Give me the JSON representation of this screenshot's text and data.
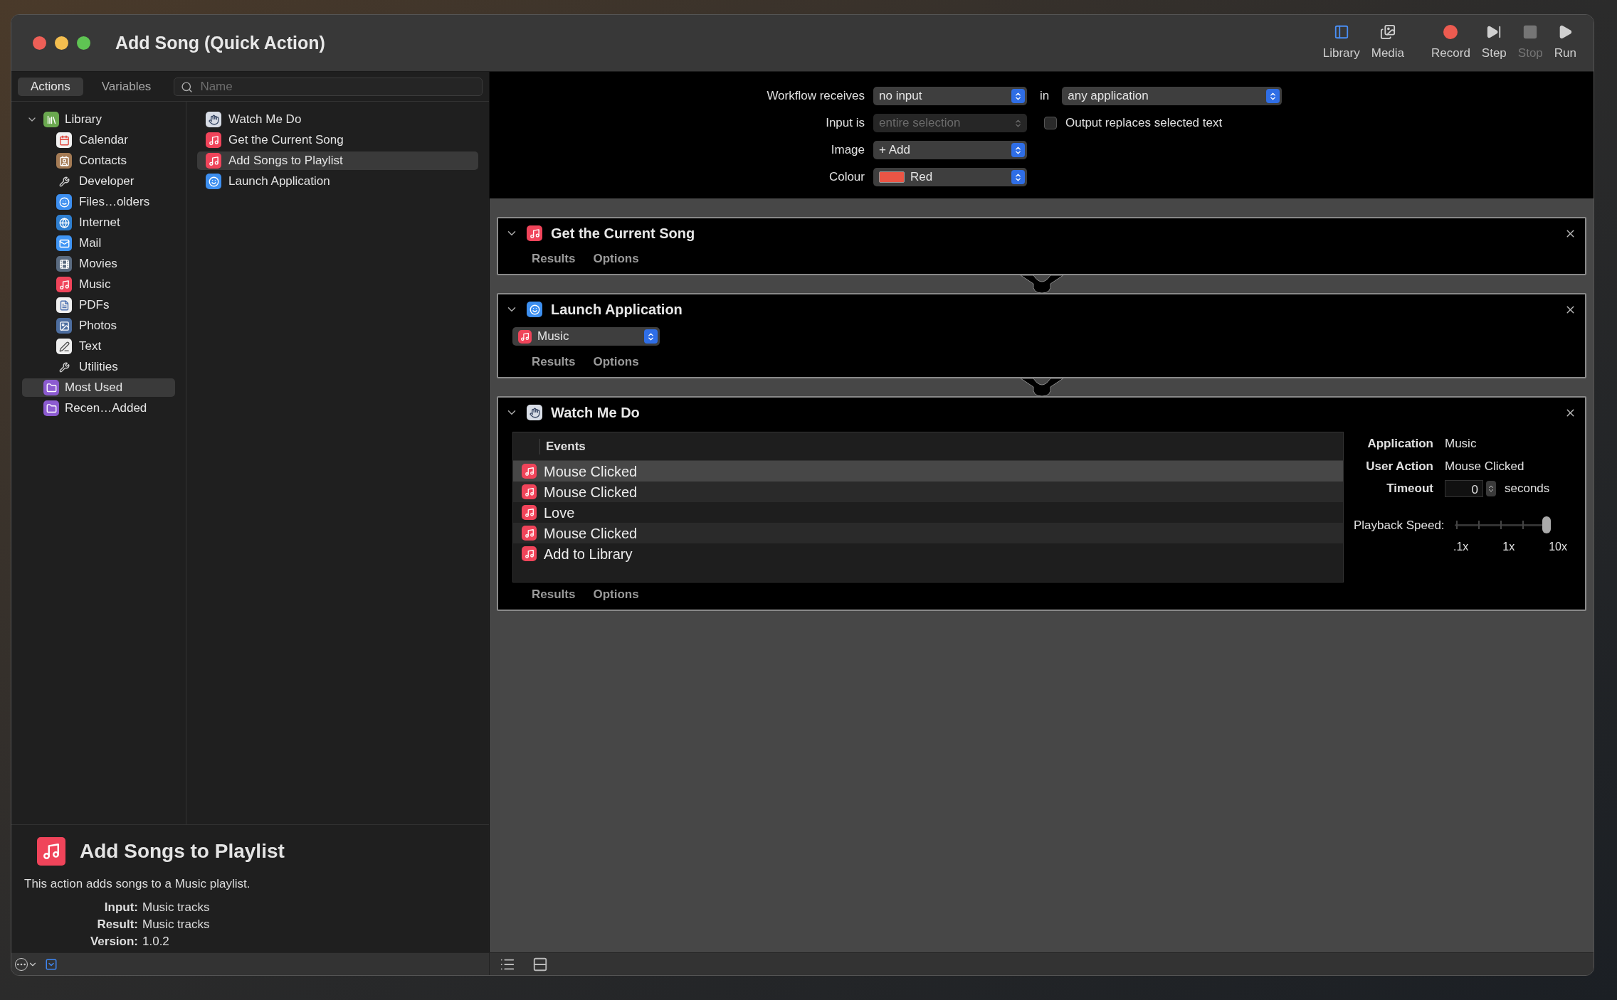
{
  "window": {
    "title": "Add Song (Quick Action)"
  },
  "toolbar": [
    {
      "label": "Library",
      "kind": "library",
      "disabled": false
    },
    {
      "label": "Media",
      "kind": "media",
      "disabled": false
    },
    {
      "label": "Record",
      "kind": "record",
      "disabled": false
    },
    {
      "label": "Step",
      "kind": "step",
      "disabled": false
    },
    {
      "label": "Stop",
      "kind": "stop",
      "disabled": true
    },
    {
      "label": "Run",
      "kind": "run",
      "disabled": false
    }
  ],
  "library_tabs": [
    {
      "label": "Actions",
      "selected": true
    },
    {
      "label": "Variables",
      "selected": false
    }
  ],
  "search": {
    "placeholder": "Name"
  },
  "library_tree": [
    {
      "label": "Library",
      "kind": "library",
      "expanded": true,
      "selected": false,
      "children": [
        {
          "label": "Calendar",
          "kind": "calendar",
          "selected": false
        },
        {
          "label": "Contacts",
          "kind": "contacts",
          "selected": false
        },
        {
          "label": "Developer",
          "kind": "tools",
          "selected": false
        },
        {
          "label": "Files…olders",
          "kind": "finder",
          "selected": false
        },
        {
          "label": "Internet",
          "kind": "globe",
          "selected": false
        },
        {
          "label": "Mail",
          "kind": "mail",
          "selected": false
        },
        {
          "label": "Movies",
          "kind": "movies",
          "selected": false
        },
        {
          "label": "Music",
          "kind": "music",
          "selected": false
        },
        {
          "label": "PDFs",
          "kind": "pdf",
          "selected": false
        },
        {
          "label": "Photos",
          "kind": "photos",
          "selected": false
        },
        {
          "label": "Text",
          "kind": "text",
          "selected": false
        },
        {
          "label": "Utilities",
          "kind": "tools",
          "selected": false
        }
      ]
    },
    {
      "label": "Most Used",
      "kind": "folder",
      "selected": true
    },
    {
      "label": "Recen…Added",
      "kind": "folder",
      "selected": false
    }
  ],
  "actions": [
    {
      "label": "Watch Me Do",
      "kind": "watch",
      "selected": false
    },
    {
      "label": "Get the Current Song",
      "kind": "music",
      "selected": false
    },
    {
      "label": "Add Songs to Playlist",
      "kind": "music",
      "selected": true
    },
    {
      "label": "Launch Application",
      "kind": "finder",
      "selected": false
    }
  ],
  "workflow_settings": {
    "receives": {
      "label": "Workflow receives",
      "value": "no input"
    },
    "in": {
      "label": "in",
      "value": "any application"
    },
    "input_is": {
      "label": "Input is",
      "value": "entire selection",
      "disabled": true
    },
    "output_replaces": {
      "label": "Output replaces selected text",
      "checked": false
    },
    "image": {
      "label": "Image",
      "value": "+ Add"
    },
    "colour": {
      "label": "Colour",
      "value": "Red",
      "color": "#eb5545"
    }
  },
  "workflow_actions": [
    {
      "title": "Get the Current Song",
      "kind": "music",
      "expanded": true,
      "tabs": [
        "Results",
        "Options"
      ]
    },
    {
      "title": "Launch Application",
      "kind": "finder",
      "expanded": true,
      "app_select": {
        "value": "Music",
        "kind": "music"
      },
      "tabs": [
        "Results",
        "Options"
      ]
    },
    {
      "title": "Watch Me Do",
      "kind": "watch",
      "expanded": true,
      "events_header": "Events",
      "events": [
        {
          "label": "Mouse Clicked",
          "kind": "music",
          "selected": true
        },
        {
          "label": "Mouse Clicked",
          "kind": "music",
          "selected": false
        },
        {
          "label": "Love",
          "kind": "music",
          "selected": false
        },
        {
          "label": "Mouse Clicked",
          "kind": "music",
          "selected": false
        },
        {
          "label": "Add to Library",
          "kind": "music",
          "selected": false
        }
      ],
      "details": [
        {
          "label": "Application",
          "value": "Music"
        },
        {
          "label": "User Action",
          "value": "Mouse Clicked"
        }
      ],
      "timeout": {
        "label": "Timeout",
        "value": "0",
        "unit": "seconds"
      },
      "playback": {
        "label": "Playback Speed:",
        "level": 1,
        "ticks": [
          ".1x",
          "1x",
          "10x"
        ]
      },
      "tabs": [
        "Results",
        "Options"
      ]
    }
  ],
  "description": {
    "title": "Add Songs to Playlist",
    "kind": "music",
    "text": "This action adds songs to a Music playlist.",
    "fields": [
      {
        "label": "Input:",
        "value": "Music tracks"
      },
      {
        "label": "Result:",
        "value": "Music tracks"
      },
      {
        "label": "Version:",
        "value": "1.0.2"
      }
    ]
  }
}
